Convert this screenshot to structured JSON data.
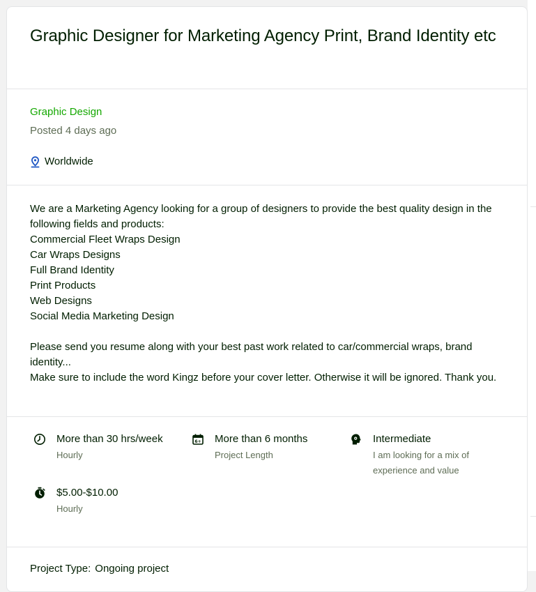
{
  "job": {
    "title": "Graphic Designer for Marketing Agency Print, Brand Identity etc",
    "category": "Graphic Design",
    "posted": "Posted 4 days ago",
    "location": "Worldwide",
    "description": "We are a Marketing Agency looking for a group of designers to provide the best quality design in the following fields and products:\nCommercial Fleet Wraps Design\nCar Wraps Designs\nFull Brand Identity\nPrint Products\nWeb Designs\nSocial Media Marketing Design\n\nPlease send you resume along with your best past work related to car/commercial wraps, brand identity...\nMake sure to include the word Kingz before your cover letter. Otherwise it will be ignored. Thank you."
  },
  "features": {
    "hours": {
      "main": "More than 30 hrs/week",
      "sub": "Hourly",
      "icon": "clock-icon"
    },
    "length": {
      "main": "More than 6 months",
      "sub": "Project Length",
      "icon": "calendar-icon"
    },
    "level": {
      "main": "Intermediate",
      "sub": "I am looking for a mix of experience and value",
      "icon": "brain-icon"
    },
    "rate": {
      "main": "$5.00-$10.00",
      "sub": "Hourly",
      "icon": "stopwatch-icon"
    }
  },
  "project_type": {
    "label": "Project Type:",
    "value": "Ongoing project"
  },
  "colors": {
    "accent_green": "#14a800",
    "text_dark": "#001e00",
    "text_muted": "#5e6d55",
    "border": "#e4e5e7"
  }
}
